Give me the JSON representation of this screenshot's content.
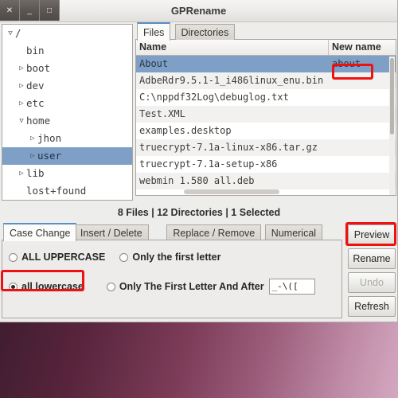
{
  "window": {
    "title": "GPRename",
    "controls": [
      {
        "name": "close",
        "glyph": "✕"
      },
      {
        "name": "minimize",
        "glyph": "_"
      },
      {
        "name": "maximize",
        "glyph": "□"
      }
    ]
  },
  "tree": {
    "items": [
      {
        "label": "/",
        "indent": 0,
        "twisty": "open",
        "selected": false
      },
      {
        "label": "bin",
        "indent": 1,
        "twisty": "none",
        "selected": false
      },
      {
        "label": "boot",
        "indent": 1,
        "twisty": "closed",
        "selected": false
      },
      {
        "label": "dev",
        "indent": 1,
        "twisty": "closed",
        "selected": false
      },
      {
        "label": "etc",
        "indent": 1,
        "twisty": "closed",
        "selected": false
      },
      {
        "label": "home",
        "indent": 1,
        "twisty": "open",
        "selected": false
      },
      {
        "label": "jhon",
        "indent": 2,
        "twisty": "closed",
        "selected": false
      },
      {
        "label": "user",
        "indent": 2,
        "twisty": "closed",
        "selected": true
      },
      {
        "label": "lib",
        "indent": 1,
        "twisty": "closed",
        "selected": false
      },
      {
        "label": "lost+found",
        "indent": 1,
        "twisty": "none",
        "selected": false
      }
    ]
  },
  "files_panel": {
    "tabs": [
      {
        "label": "Files",
        "active": true
      },
      {
        "label": "Directories",
        "active": false
      }
    ],
    "columns": [
      "Name",
      "New name"
    ],
    "rows": [
      {
        "name": "About",
        "new_name": "about",
        "selected": true
      },
      {
        "name": "AdbeRdr9.5.1-1_i486linux_enu.bin",
        "new_name": "",
        "selected": false
      },
      {
        "name": "C:\\nppdf32Log\\debuglog.txt",
        "new_name": "",
        "selected": false
      },
      {
        "name": "Test.XML",
        "new_name": "",
        "selected": false
      },
      {
        "name": "examples.desktop",
        "new_name": "",
        "selected": false
      },
      {
        "name": "truecrypt-7.1a-linux-x86.tar.gz",
        "new_name": "",
        "selected": false
      },
      {
        "name": "truecrypt-7.1a-setup-x86",
        "new_name": "",
        "selected": false
      },
      {
        "name": "webmin 1.580 all.deb",
        "new_name": "",
        "selected": false
      }
    ]
  },
  "status": {
    "text": "8 Files | 12 Directories | 1 Selected",
    "files": 8,
    "directories": 12,
    "selected": 1
  },
  "operations": {
    "tabs": [
      {
        "label": "Case Change",
        "active": true
      },
      {
        "label": "Insert / Delete",
        "active": false
      },
      {
        "label": "Replace / Remove",
        "active": false
      },
      {
        "label": "Numerical",
        "active": false
      }
    ],
    "options": [
      {
        "label": "ALL UPPERCASE",
        "checked": false
      },
      {
        "label": "Only the first letter",
        "checked": false
      },
      {
        "label": "all lowercase",
        "checked": true
      },
      {
        "label": "Only The First Letter And After",
        "checked": false
      }
    ],
    "after_field": {
      "value": "_-\\([",
      "placeholder": ""
    }
  },
  "actions": [
    {
      "label": "Preview",
      "disabled": false
    },
    {
      "label": "Rename",
      "disabled": false
    },
    {
      "label": "Undo",
      "disabled": true
    },
    {
      "label": "Refresh",
      "disabled": false
    }
  ],
  "annotations": {
    "accent_color": "#ee1111",
    "highlights": [
      "new-name-cell",
      "preview-button",
      "all-lowercase-option"
    ]
  },
  "colors": {
    "selection": "#7e9fc6",
    "window_bg": "#ededeb",
    "desktop_start": "#2e1526",
    "desktop_end": "#d4a8c0"
  }
}
